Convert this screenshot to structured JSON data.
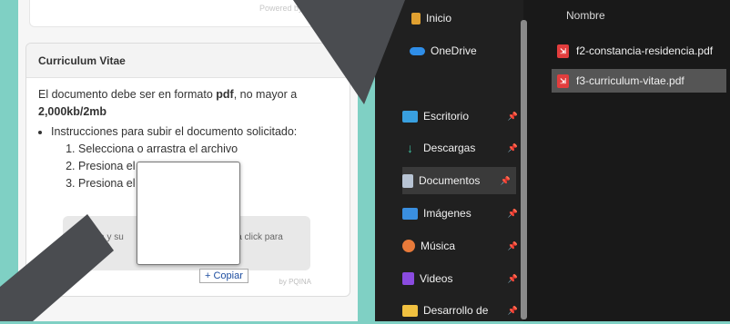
{
  "web_form": {
    "top_powered_by": "Powered by PQINA",
    "section_title": "Curriculum Vitae",
    "description_prefix": "El documento debe ser en formato ",
    "description_format": "pdf",
    "description_suffix": ", no mayor a",
    "size_limit": "2,000kb/2mb",
    "instructions_label": "Instrucciones para subir el documento solicitado:",
    "steps": [
      "Selecciona o arrastra el archivo",
      "Presiona el",
      "Presiona el"
    ],
    "dropzone_text_left": "tra y su",
    "dropzone_text_right": "la click para",
    "bottom_powered_by": "by PQINA",
    "drag_tooltip": "+ Copiar"
  },
  "explorer": {
    "nav_items": [
      {
        "label": "Inicio",
        "icon": "home-icon",
        "color": "#e0a030"
      },
      {
        "label": "OneDrive",
        "icon": "cloud-icon",
        "color": "#2f8ee8"
      },
      {
        "label": "Escritorio",
        "icon": "desktop-icon",
        "color": "#39a0e0",
        "pinned": true
      },
      {
        "label": "Descargas",
        "icon": "download-icon",
        "color": "#3fbf9f",
        "pinned": true
      },
      {
        "label": "Documentos",
        "icon": "document-icon",
        "color": "#b8c4d4",
        "pinned": true,
        "active": true
      },
      {
        "label": "Imágenes",
        "icon": "image-icon",
        "color": "#3a8fe0",
        "pinned": true
      },
      {
        "label": "Música",
        "icon": "music-icon",
        "color": "#e87a3a",
        "pinned": true
      },
      {
        "label": "Videos",
        "icon": "video-icon",
        "color": "#8a4be0",
        "pinned": true
      },
      {
        "label": "Desarrollo de",
        "icon": "folder-icon",
        "color": "#f0c040",
        "pinned": true
      }
    ],
    "column_header": "Nombre",
    "files": [
      {
        "name": "f2-constancia-residencia.pdf",
        "selected": false
      },
      {
        "name": "f3-curriculum-vitae.pdf",
        "selected": true
      }
    ]
  },
  "colors": {
    "background": "#7fd0c4",
    "overlay_shape": "#4a4c50",
    "pdf_icon": "#e23d3d"
  }
}
